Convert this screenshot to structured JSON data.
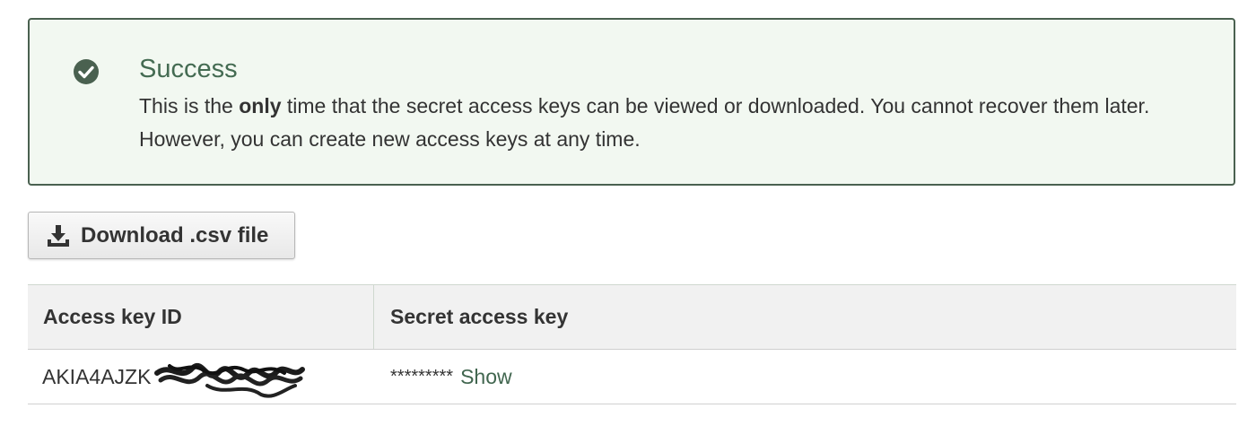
{
  "alert": {
    "icon": "check-circle-icon",
    "title": "Success",
    "body_before": "This is the ",
    "body_bold": "only",
    "body_after": " time that the secret access keys can be viewed or downloaded. You cannot recover them later. However, you can create new access keys at any time."
  },
  "download": {
    "icon": "download-icon",
    "label": "Download .csv file"
  },
  "table": {
    "headers": [
      "Access key ID",
      "Secret access key"
    ],
    "rows": [
      {
        "access_key_id": "AKIA4AJZK",
        "secret_masked": "*********",
        "show_label": "Show"
      }
    ]
  },
  "colors": {
    "success_border": "#4a6150",
    "success_bg": "#f2f8f1",
    "success_title": "#446b52",
    "link": "#41664f"
  }
}
